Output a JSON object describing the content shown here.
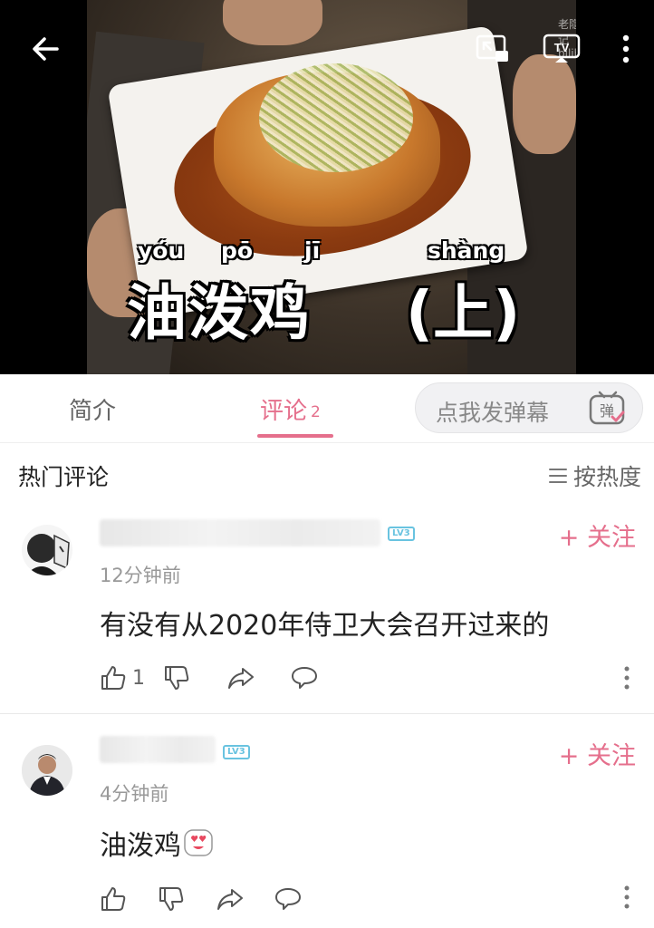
{
  "video": {
    "caption_pinyin": [
      "yóu",
      "pō",
      "jī",
      "shàng"
    ],
    "caption_hanzi": "油泼鸡",
    "caption_part": "(上)",
    "watermark": "老隐记 bilibili",
    "icons": [
      "back-arrow-icon",
      "pip-icon",
      "tv-cast-icon",
      "more-vertical-icon"
    ]
  },
  "tabs": {
    "intro": "简介",
    "comments": "评论",
    "comments_count": "2",
    "danmaku_placeholder": "点我发弹幕",
    "danmaku_icon_char": "弹"
  },
  "section": {
    "title": "热门评论",
    "sort_label": "按热度"
  },
  "colors": {
    "accent": "#e56f8c",
    "level_badge": "#69c3e0"
  },
  "comments": [
    {
      "level": "LV3",
      "follow": "+ 关注",
      "time": "12分钟前",
      "text": "有没有从2020年侍卫大会召开过来的",
      "likes": "1"
    },
    {
      "level": "LV3",
      "follow": "+ 关注",
      "time": "4分钟前",
      "text": "油泼鸡",
      "likes": ""
    }
  ]
}
